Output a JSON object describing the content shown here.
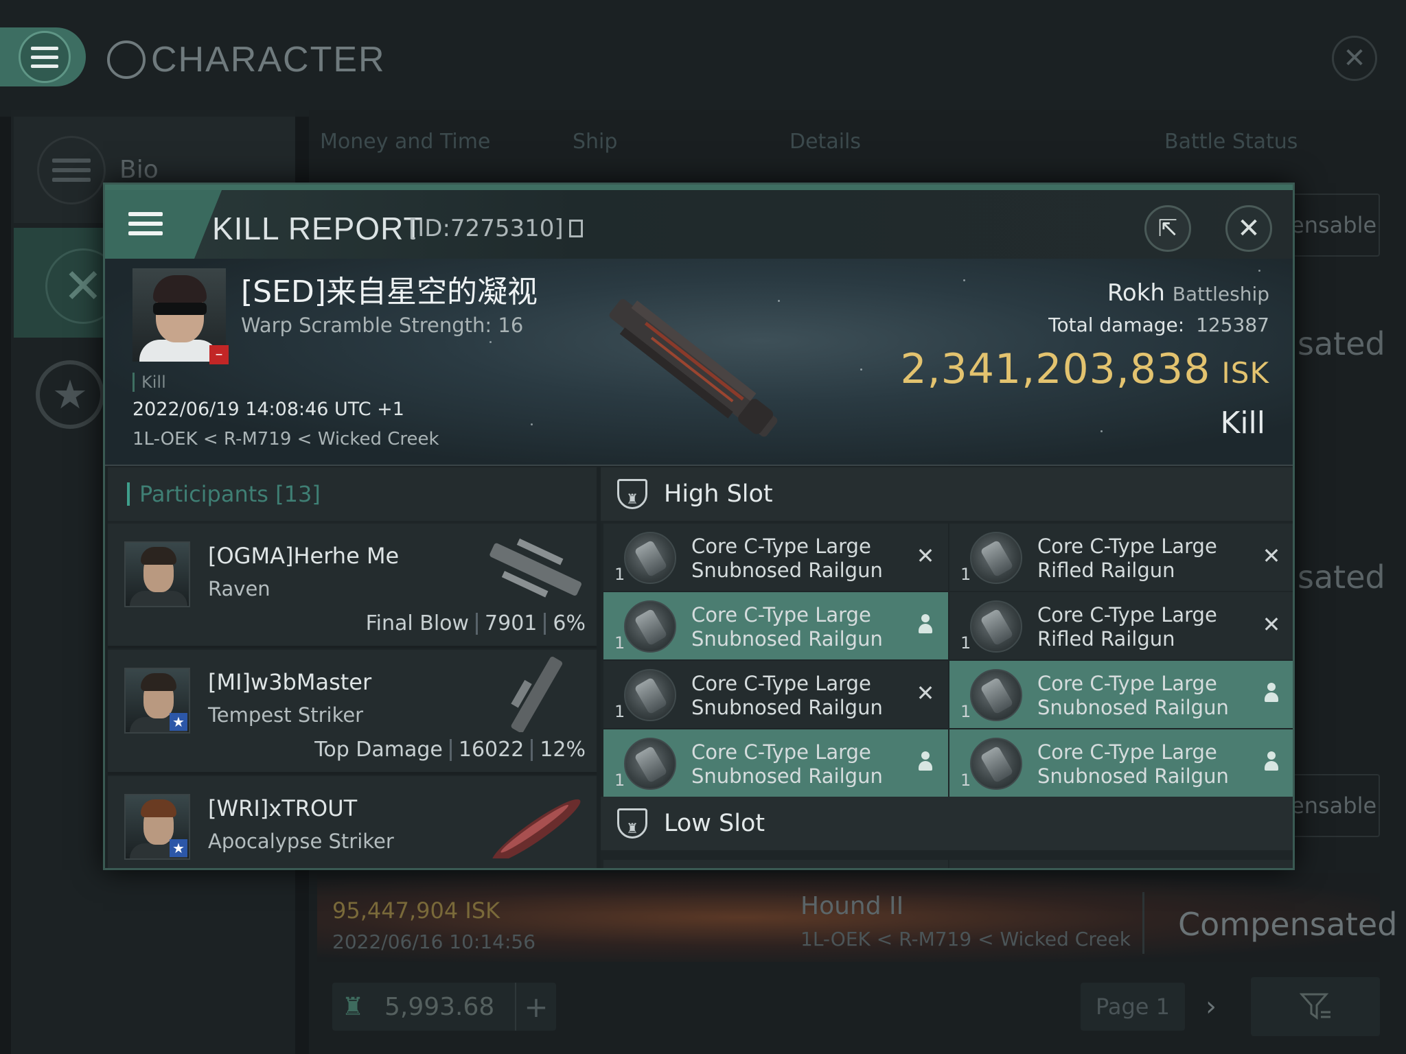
{
  "background": {
    "window_title": "CHARACTER",
    "sidebar": {
      "bio_label": "Bio"
    },
    "tabs": [
      "Money and Time",
      "Ship",
      "Details",
      "Battle Status"
    ],
    "right_texts": [
      "sated",
      "sated"
    ],
    "pills": [
      "ensable",
      "ensable"
    ],
    "row": {
      "isk": "95,447,904  ISK",
      "date": "2022/06/16  10:14:56",
      "ship": "Hound II",
      "location": "1L-OEK < R-M719 < Wicked Creek",
      "status": "Compensated"
    },
    "wallet": {
      "value": "5,993.68",
      "plus": "+"
    },
    "pager": {
      "page_label": "Page 1",
      "next": "›"
    }
  },
  "dialog": {
    "title": "KILL REPORT",
    "id_label": "[ID:7275310]",
    "victim": {
      "name": "[SED]来自星空的凝视",
      "warp_scramble": "Warp Scramble Strength: 16",
      "kill_tag": "Kill",
      "timestamp": "2022/06/19 14:08:46 UTC +1",
      "location": "1L-OEK < R-M719 < Wicked Creek",
      "ship_name": "Rokh",
      "ship_class": "Battleship",
      "total_damage_label": "Total damage:",
      "total_damage": "125387",
      "isk_value": "2,341,203,838",
      "isk_unit": "ISK",
      "result": "Kill",
      "badge": "–"
    },
    "participants": {
      "header": "Participants [13]",
      "rows": [
        {
          "name": "[OGMA]Herhe Me",
          "ship": "Raven",
          "role": "Final Blow",
          "damage": "7901",
          "percent": "6%",
          "star": false
        },
        {
          "name": "[MI]w3bMaster",
          "ship": "Tempest Striker",
          "role": "Top Damage",
          "damage": "16022",
          "percent": "12%",
          "star": true
        },
        {
          "name": "[WRI]xTROUT",
          "ship": "Apocalypse Striker",
          "role": "",
          "damage": "",
          "percent": "",
          "star": true
        }
      ]
    },
    "high_slot": {
      "label": "High Slot",
      "items": [
        {
          "qty": "1",
          "line1": "Core C-Type Large",
          "line2": "Snubnosed Railgun",
          "status": "destroyed"
        },
        {
          "qty": "1",
          "line1": "Core C-Type Large",
          "line2": "Rifled Railgun",
          "status": "destroyed"
        },
        {
          "qty": "1",
          "line1": "Core C-Type Large",
          "line2": "Snubnosed Railgun",
          "status": "dropped"
        },
        {
          "qty": "1",
          "line1": "Core C-Type Large",
          "line2": "Rifled Railgun",
          "status": "destroyed"
        },
        {
          "qty": "1",
          "line1": "Core C-Type Large",
          "line2": "Snubnosed Railgun",
          "status": "destroyed"
        },
        {
          "qty": "1",
          "line1": "Core C-Type Large",
          "line2": "Snubnosed Railgun",
          "status": "dropped"
        },
        {
          "qty": "1",
          "line1": "Core C-Type Large",
          "line2": "Snubnosed Railgun",
          "status": "dropped"
        },
        {
          "qty": "1",
          "line1": "Core C-Type Large",
          "line2": "Snubnosed Railgun",
          "status": "dropped"
        }
      ]
    },
    "low_slot": {
      "label": "Low Slot"
    },
    "icons": {
      "menu": "hamburger-icon",
      "share": "external-link-icon",
      "close": "close-icon",
      "destroyed": "x-icon",
      "dropped": "person-icon",
      "slot": "shield-icon"
    },
    "colors": {
      "accent": "#3f6f62",
      "dropped_bg": "#4b7d71",
      "isk_gold": "#e3c36f",
      "loss_badge": "#c22626",
      "star_badge": "#2c57a8"
    }
  }
}
